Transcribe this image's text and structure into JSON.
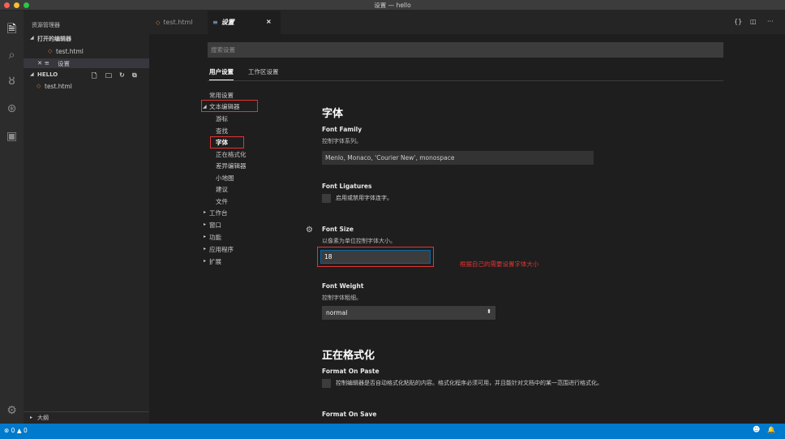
{
  "window": {
    "title": "设置 — hello",
    "traffic_colors": {
      "close": "#fe5f57",
      "minimize": "#febc2e",
      "maximize": "#28c840"
    }
  },
  "activity_bar": {
    "icons": [
      "files-icon",
      "search-icon",
      "source-control-icon",
      "debug-icon",
      "extensions-icon"
    ],
    "bottom_icon": "gear-icon"
  },
  "sidebar": {
    "header": "资源管理器",
    "open_editors": {
      "label": "打开的编辑器",
      "items": [
        {
          "icon": "◇",
          "name": "test.html"
        },
        {
          "prefix": "✕ ≡",
          "name": "设置"
        }
      ]
    },
    "folder": {
      "label": "HELLO",
      "tools": [
        "new-file-icon",
        "new-folder-icon",
        "refresh-icon",
        "collapse-icon"
      ],
      "items": [
        {
          "icon": "◇",
          "name": "test.html"
        }
      ]
    },
    "outline_label": "大纲"
  },
  "tabs": [
    {
      "icon": "◇",
      "label": "test.html",
      "active": false
    },
    {
      "icon": "≡",
      "label": "设置",
      "active": true,
      "close": "×"
    }
  ],
  "tab_tools": {
    "split": "{}",
    "layout": "◫",
    "more": "···"
  },
  "settings": {
    "search_placeholder": "搜索设置",
    "scope_tabs": [
      "用户设置",
      "工作区设置"
    ],
    "toc": {
      "common": "常用设置",
      "text_editor": "文本编辑器",
      "text_editor_children": [
        "游标",
        "查找",
        "字体",
        "正在格式化",
        "差异编辑器",
        "小地图",
        "建议",
        "文件"
      ],
      "others": [
        "工作台",
        "窗口",
        "功能",
        "应用程序",
        "扩展"
      ]
    },
    "font_section": {
      "heading": "字体",
      "font_family": {
        "title": "Font Family",
        "desc": "控制字体系列。",
        "value": "Menlo, Monaco, 'Courier New', monospace"
      },
      "font_ligatures": {
        "title": "Font Ligatures",
        "desc": "启用或禁用字体连字。"
      },
      "font_size": {
        "title": "Font Size",
        "desc": "以像素为单位控制字体大小。",
        "value": "18"
      },
      "font_weight": {
        "title": "Font Weight",
        "desc": "控制字体粗细。",
        "value": "normal"
      }
    },
    "format_section": {
      "heading": "正在格式化",
      "format_on_paste": {
        "title": "Format On Paste",
        "desc": "控制编辑器是否自动格式化粘贴的内容。格式化程序必须可用，并且能针对文档中的某一范围进行格式化。"
      },
      "format_on_save": {
        "title": "Format On Save"
      }
    },
    "annotation": "根据自己的需要设置字体大小"
  },
  "status_bar": {
    "problems": "⊗ 0 ▲ 0",
    "smiley": "☻",
    "bell": "🔔"
  }
}
